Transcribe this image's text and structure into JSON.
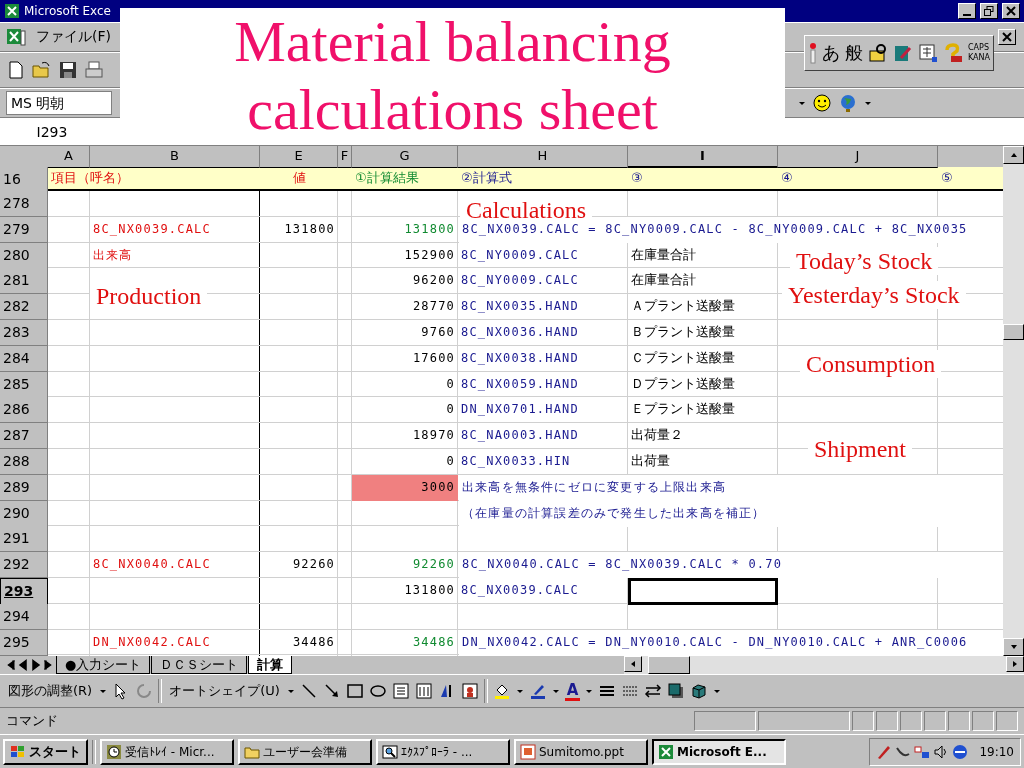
{
  "window": {
    "title": "Microsoft Exce"
  },
  "slide_title": "Material balancing calculations sheet",
  "menu": [
    "ファイル(F)"
  ],
  "ime_bar": {
    "mode": "あ",
    "conversion": "般",
    "caps": "CAPS",
    "kana": "KANA"
  },
  "font_box": {
    "value": "MS 明朝"
  },
  "name_box": {
    "value": "I293"
  },
  "columns": [
    {
      "label": "A",
      "selected": false
    },
    {
      "label": "B",
      "selected": false
    },
    {
      "label": "E",
      "selected": false
    },
    {
      "label": "F",
      "selected": false
    },
    {
      "label": "G",
      "selected": false
    },
    {
      "label": "H",
      "selected": false
    },
    {
      "label": "I",
      "selected": true
    },
    {
      "label": "J",
      "selected": false
    }
  ],
  "header": {
    "row": "16",
    "cells": [
      "項目（呼名）",
      "値",
      "①計算結果",
      "②計算式",
      "③",
      "④",
      "⑤"
    ]
  },
  "rows": [
    {
      "row": "278",
      "selected": false
    },
    {
      "row": "279",
      "selected": false,
      "b": "8C_NX0039.CALC",
      "e": "131800",
      "g": "131800",
      "result": true,
      "flagged": false,
      "h": "8C_NX0039.CALC = 8C_NY0009.CALC - 8C_NY0009.CALC + 8C_NX0035"
    },
    {
      "row": "280",
      "selected": false,
      "b": "出来高",
      "g": "152900",
      "result": false,
      "flagged": false,
      "h": "8C_NY0009.CALC",
      "i": "在庫量合計"
    },
    {
      "row": "281",
      "selected": false,
      "g": "96200",
      "result": false,
      "flagged": false,
      "h": "8C_NY0009.CALC",
      "i": "在庫量合計"
    },
    {
      "row": "282",
      "selected": false,
      "g": "28770",
      "result": false,
      "flagged": false,
      "h": "8C_NX0035.HAND",
      "i": "Ａプラント送酸量"
    },
    {
      "row": "283",
      "selected": false,
      "g": "9760",
      "result": false,
      "flagged": false,
      "h": "8C_NX0036.HAND",
      "i": "Ｂプラント送酸量"
    },
    {
      "row": "284",
      "selected": false,
      "g": "17600",
      "result": false,
      "flagged": false,
      "h": "8C_NX0038.HAND",
      "i": "Ｃプラント送酸量"
    },
    {
      "row": "285",
      "selected": false,
      "g": "0",
      "result": false,
      "flagged": false,
      "h": "8C_NX0059.HAND",
      "i": "Ｄプラント送酸量"
    },
    {
      "row": "286",
      "selected": false,
      "g": "0",
      "result": false,
      "flagged": false,
      "h": "DN_NX0701.HAND",
      "i": "Ｅプラント送酸量"
    },
    {
      "row": "287",
      "selected": false,
      "g": "18970",
      "result": false,
      "flagged": false,
      "h": "8C_NA0003.HAND",
      "i": "出荷量２"
    },
    {
      "row": "288",
      "selected": false,
      "g": "0",
      "result": false,
      "flagged": false,
      "h": "8C_NX0033.HIN",
      "i": "出荷量"
    },
    {
      "row": "289",
      "selected": false,
      "g": "3000",
      "result": false,
      "flagged": true,
      "h": "出来高を無条件にゼロに変更する上限出来高"
    },
    {
      "row": "290",
      "selected": false,
      "h": "（在庫量の計算誤差のみで発生した出来高を補正）"
    },
    {
      "row": "291",
      "selected": false
    },
    {
      "row": "292",
      "selected": false,
      "b": "8C_NX0040.CALC",
      "e": "92260",
      "g": "92260",
      "result": true,
      "flagged": false,
      "h": "8C_NX0040.CALC = 8C_NX0039.CALC * 0.70"
    },
    {
      "row": "293",
      "selected": true,
      "g": "131800",
      "result": false,
      "flagged": false,
      "h": "8C_NX0039.CALC"
    },
    {
      "row": "294",
      "selected": false
    },
    {
      "row": "295",
      "selected": false,
      "b": "DN_NX0042.CALC",
      "e": "34486",
      "g": "34486",
      "result": true,
      "flagged": false,
      "h": "DN_NX0042.CALC = DN_NY0010.CALC - DN_NY0010.CALC + ANR_C0006"
    }
  ],
  "annotations": [
    "Calculations",
    "Production",
    "Today’s Stock",
    "Yesterday’s Stock",
    "Consumption",
    "Shipment"
  ],
  "sheet_tabs": [
    {
      "label": "●入力シート",
      "selected": false
    },
    {
      "label": "ＤＣＳシート",
      "selected": false
    },
    {
      "label": "計算",
      "selected": true
    }
  ],
  "drawing_toolbar": {
    "draw_menu": "図形の調整(R)",
    "autoshapes": "オートシェイプ(U)",
    "font_color": "A"
  },
  "status_bar": {
    "text": "コマンド"
  },
  "taskbar": {
    "start": "スタート",
    "tasks": [
      {
        "label": "受信ﾄﾚｲ - Micr...",
        "selected": false
      },
      {
        "label": "ユーザー会準備",
        "selected": false
      },
      {
        "label": "ｴｸｽﾌﾟﾛｰﾗ - ...",
        "selected": false
      },
      {
        "label": "Sumitomo.ppt",
        "selected": false
      },
      {
        "label": "Microsoft E...",
        "selected": true
      }
    ],
    "clock": "19:10"
  }
}
